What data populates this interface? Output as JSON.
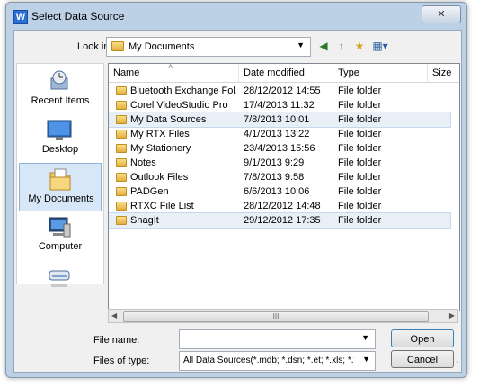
{
  "window": {
    "title": "Select Data Source",
    "app_icon_letter": "W",
    "close_glyph": "✕"
  },
  "lookin": {
    "label": "Look in:",
    "value": "My Documents",
    "arrow": "▼"
  },
  "toolbar": {
    "back_glyph": "◀",
    "up_glyph": "↑",
    "newfolder_glyph": "★",
    "views_glyph": "▦▾"
  },
  "places": [
    {
      "label": "Recent Items",
      "icon": "recent-items-icon"
    },
    {
      "label": "Desktop",
      "icon": "desktop-icon"
    },
    {
      "label": "My Documents",
      "icon": "my-documents-icon",
      "selected": true
    },
    {
      "label": "Computer",
      "icon": "computer-icon"
    },
    {
      "label": "",
      "icon": "network-drive-icon"
    }
  ],
  "columns": [
    {
      "label": "Name"
    },
    {
      "label": "Date modified"
    },
    {
      "label": "Type"
    },
    {
      "label": "Size"
    }
  ],
  "sort_glyph": "˄",
  "files": [
    {
      "name": "Bluetooth Exchange Fol...",
      "date": "28/12/2012 14:55",
      "type": "File folder"
    },
    {
      "name": "Corel VideoStudio Pro",
      "date": "17/4/2013 11:32",
      "type": "File folder"
    },
    {
      "name": "My Data Sources",
      "date": "7/8/2013 10:01",
      "type": "File folder",
      "selected": true
    },
    {
      "name": "My RTX Files",
      "date": "4/1/2013 13:22",
      "type": "File folder"
    },
    {
      "name": "My Stationery",
      "date": "23/4/2013 15:56",
      "type": "File folder"
    },
    {
      "name": "Notes",
      "date": "9/1/2013 9:29",
      "type": "File folder"
    },
    {
      "name": "Outlook Files",
      "date": "7/8/2013 9:58",
      "type": "File folder"
    },
    {
      "name": "PADGen",
      "date": "6/6/2013 10:06",
      "type": "File folder"
    },
    {
      "name": "RTXC File List",
      "date": "28/12/2012 14:48",
      "type": "File folder"
    },
    {
      "name": "SnagIt",
      "date": "29/12/2012 17:35",
      "type": "File folder",
      "selected": true
    }
  ],
  "hscroll": {
    "left": "◀",
    "right": "▶",
    "thumb": "III"
  },
  "filename": {
    "label": "File name:",
    "value": "",
    "arrow": "▼"
  },
  "filetype": {
    "label": "Files of type:",
    "value": "All Data Sources(*.mdb; *.dsn; *.et; *.xls; *.txt; *..",
    "arrow": "▼"
  },
  "buttons": {
    "open": "Open",
    "cancel": "Cancel"
  },
  "colors": {
    "title_bar": "#bcd0e6",
    "selection": "#e8eff7",
    "accent": "#2b6fd6"
  }
}
